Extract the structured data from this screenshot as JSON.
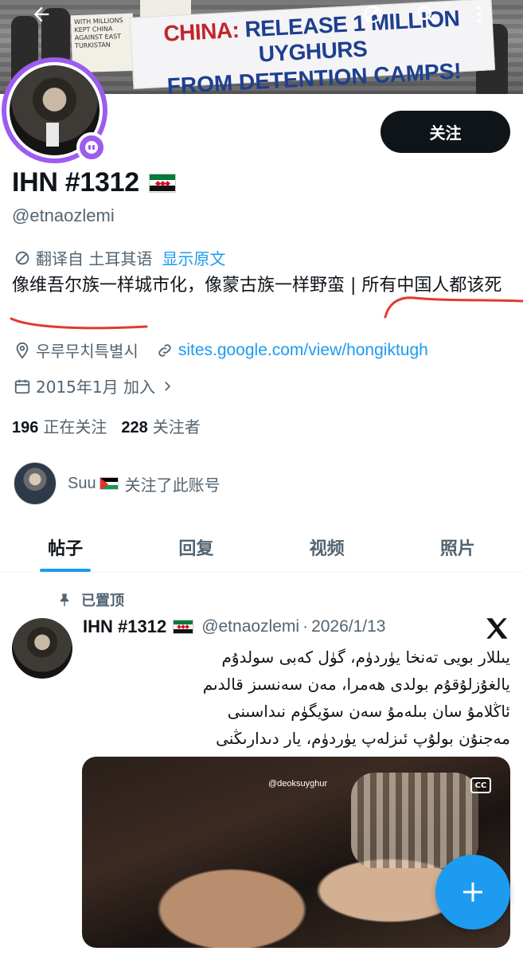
{
  "banner": {
    "protest_line1_red": "CHINA:",
    "protest_line1": "RELEASE 1 MILLION UYGHURS",
    "protest_line2": "FROM DETENTION CAMPS!",
    "sign_text": "WITH MILLIONS KEPT CHINA AGAINST EAST TURKISTAN"
  },
  "top_bar": {
    "back_icon": "arrow-left-icon",
    "icons": [
      "grok-icon",
      "search-icon",
      "more-vertical-icon"
    ]
  },
  "profile": {
    "name": "IHN #1312",
    "handle": "@etnaozlemi",
    "follow_label": "关注",
    "translate_label": "翻译自 土耳其语",
    "show_original": "显示原文",
    "bio": "像维吾尔族一样城市化，像蒙古族一样野蛮 | 所有中国人都该死",
    "location": "우루무치특별시",
    "website": "sites.google.com/view/hongiktugh",
    "joined": "2015年1月 加入",
    "following_count": "196",
    "following_label": "正在关注",
    "followers_count": "228",
    "followers_label": "关注者",
    "followed_by_name": "Suu",
    "followed_by_text": "关注了此账号"
  },
  "tabs": [
    {
      "label": "帖子"
    },
    {
      "label": "回复"
    },
    {
      "label": "视频"
    },
    {
      "label": "照片"
    }
  ],
  "post": {
    "pinned_label": "已置顶",
    "author_name": "IHN #1312",
    "author_handle": "@etnaozlemi",
    "separator": "·",
    "date": "2026/1/13",
    "text_lines": [
      "يىللار بويى تەنخا يۈردۈم، گۈل كەبى سولدۇم",
      "يالغۇزلۇقۇم بولدى ھەمرا، مەن سەنسىز قالدىم",
      "ئاڭلامۇ سان بىلەمۇ سەن سۆيگۈم نىداسىنى",
      "مەجنۇن بولۇپ ئىزلەپ يۈردۈم، يار دىدارىڭنى"
    ],
    "media_watermark": "@deoksuyghur",
    "media_cc": "CC"
  },
  "colors": {
    "accent": "#1d9bf0",
    "avatar_ring": "#9d5cf0",
    "annotation": "#e03a2f"
  }
}
